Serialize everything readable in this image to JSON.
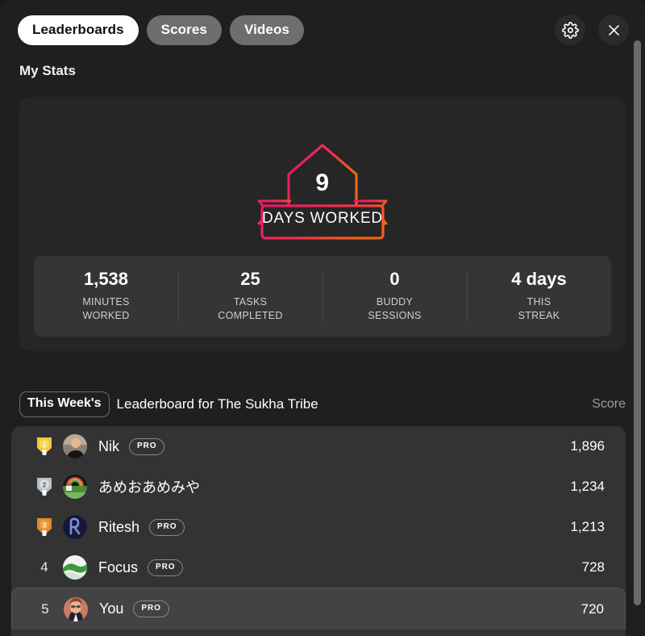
{
  "window": {
    "background_color": "#1f1f1f",
    "outside_color": "#1a1a1a"
  },
  "topbar": {
    "tabs": [
      {
        "label": "Leaderboards",
        "active": true
      },
      {
        "label": "Scores",
        "active": false
      },
      {
        "label": "Videos",
        "active": false
      }
    ],
    "settings_icon": "gear-icon",
    "close_icon": "close-icon"
  },
  "my_stats": {
    "title": "My Stats",
    "badge": {
      "number": "9",
      "label": "DAYS WORKED",
      "gradient_from": "#ec1e63",
      "gradient_to": "#f4611a"
    },
    "stats": [
      {
        "value": "1,538",
        "label_line1": "MINUTES",
        "label_line2": "WORKED"
      },
      {
        "value": "25",
        "label_line1": "TASKS",
        "label_line2": "COMPLETED"
      },
      {
        "value": "0",
        "label_line1": "BUDDY",
        "label_line2": "SESSIONS"
      },
      {
        "value": "4 days",
        "label_line1": "THIS",
        "label_line2": "STREAK"
      }
    ]
  },
  "leaderboard": {
    "period_selector": "This Week's",
    "title": "Leaderboard for The Sukha Tribe",
    "score_column_header": "Score",
    "rows": [
      {
        "rank": "1",
        "medal": "gold",
        "name": "Nik",
        "pro": "PRO",
        "score": "1,896",
        "is_me": false,
        "avatar": "photo-man"
      },
      {
        "rank": "2",
        "medal": "silver",
        "name": "あめおあめみや",
        "pro": "",
        "score": "1,234",
        "is_me": false,
        "avatar": "rainbow-landscape"
      },
      {
        "rank": "3",
        "medal": "bronze",
        "name": "Ritesh",
        "pro": "PRO",
        "score": "1,213",
        "is_me": false,
        "avatar": "logo-p"
      },
      {
        "rank": "4",
        "medal": "",
        "name": "Focus",
        "pro": "PRO",
        "score": "728",
        "is_me": false,
        "avatar": "green-hill"
      },
      {
        "rank": "5",
        "medal": "",
        "name": "You",
        "pro": "PRO",
        "score": "720",
        "is_me": true,
        "avatar": "photo-woman"
      }
    ]
  },
  "scrollbar": {
    "orientation": "vertical",
    "thumb_color": "#6b6b6b"
  }
}
